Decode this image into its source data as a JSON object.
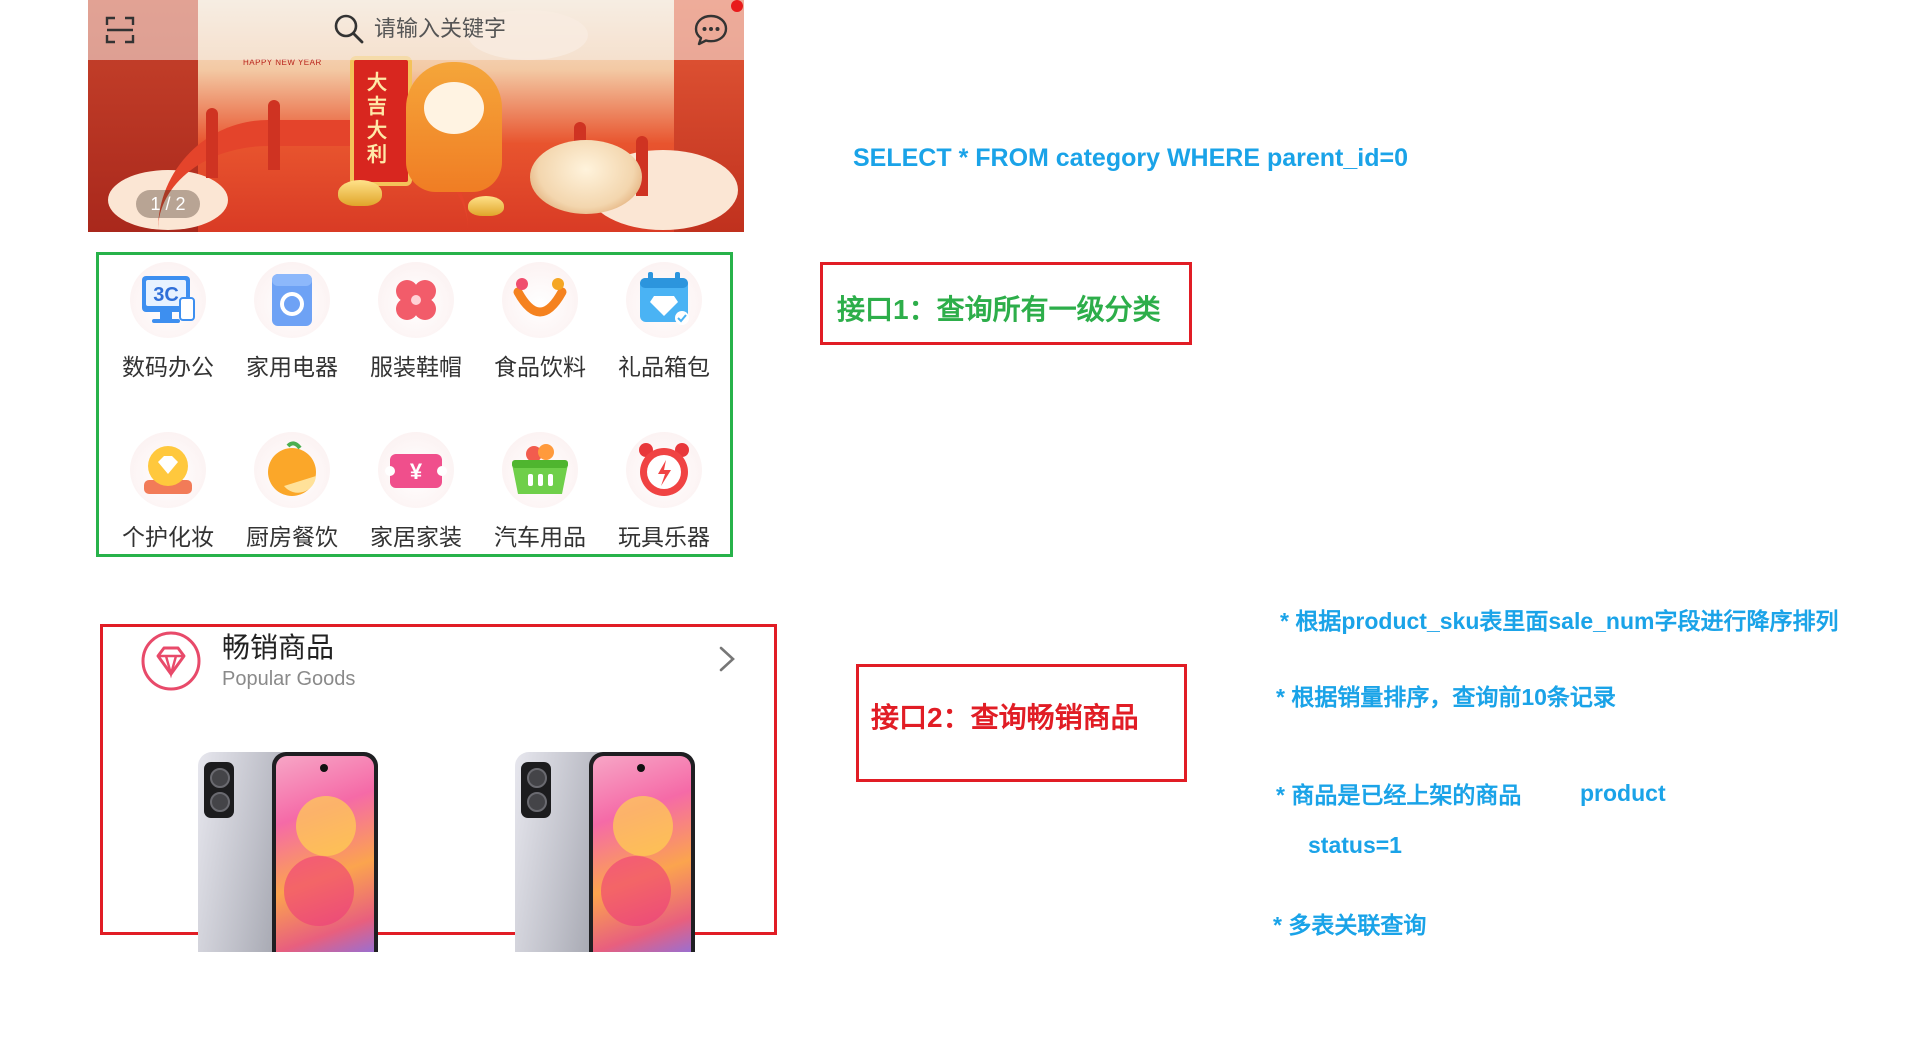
{
  "header": {
    "search_placeholder": "请输入关键字",
    "banner_counter": "1 / 2",
    "banner_small_text": "HAPPY NEW YEAR",
    "banner_scroll_text": "大吉大利"
  },
  "categories": [
    {
      "label": "数码办公",
      "icon": "3c-computer-icon"
    },
    {
      "label": "家用电器",
      "icon": "washing-machine-icon"
    },
    {
      "label": "服装鞋帽",
      "icon": "clover-icon"
    },
    {
      "label": "食品饮料",
      "icon": "smile-cup-icon"
    },
    {
      "label": "礼品箱包",
      "icon": "calendar-gift-icon"
    },
    {
      "label": "个护化妆",
      "icon": "diamond-cushion-icon"
    },
    {
      "label": "厨房餐饮",
      "icon": "orange-icon"
    },
    {
      "label": "家居家装",
      "icon": "yen-ticket-icon"
    },
    {
      "label": "汽车用品",
      "icon": "basket-icon"
    },
    {
      "label": "玩具乐器",
      "icon": "alarm-clock-icon"
    }
  ],
  "popular": {
    "title": "畅销商品",
    "subtitle": "Popular Goods"
  },
  "annotations": {
    "sql": "SELECT * FROM category WHERE parent_id=0",
    "api1": "接口1：查询所有一级分类",
    "api2": "接口2：查询畅销商品",
    "notes": [
      "* 根据product_sku表里面sale_num字段进行降序排列",
      "* 根据销量排序，查询前10条记录",
      "* 商品是已经上架的商品",
      "product",
      "status=1",
      "* 多表关联查询"
    ]
  },
  "colors": {
    "green_box": "#27b24a",
    "red_box": "#e11d25",
    "blue_text": "#1aa3e8",
    "green_text": "#2dae4a"
  }
}
